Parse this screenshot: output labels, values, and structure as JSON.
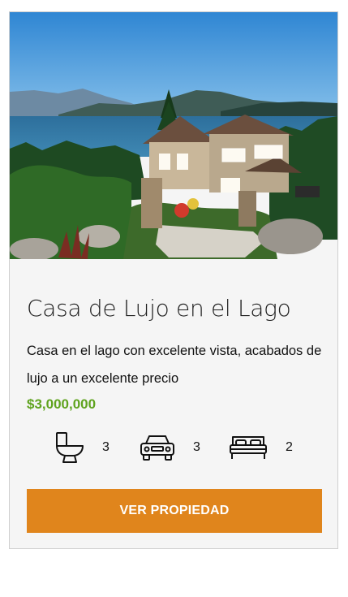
{
  "card": {
    "image_alt_icon": "house-by-lake-photo",
    "title": "Casa de Lujo en el Lago",
    "description": "Casa en el lago con excelente vista, acabados de lujo a un excelente precio",
    "price": "$3,000,000",
    "features": [
      {
        "icon": "toilet-icon",
        "value": "3"
      },
      {
        "icon": "car-icon",
        "value": "3"
      },
      {
        "icon": "bed-icon",
        "value": "2"
      }
    ],
    "button_label": "VER PROPIEDAD"
  },
  "colors": {
    "accent": "#e0851c",
    "price": "#5fa31e",
    "card_bg": "#f5f5f5"
  }
}
